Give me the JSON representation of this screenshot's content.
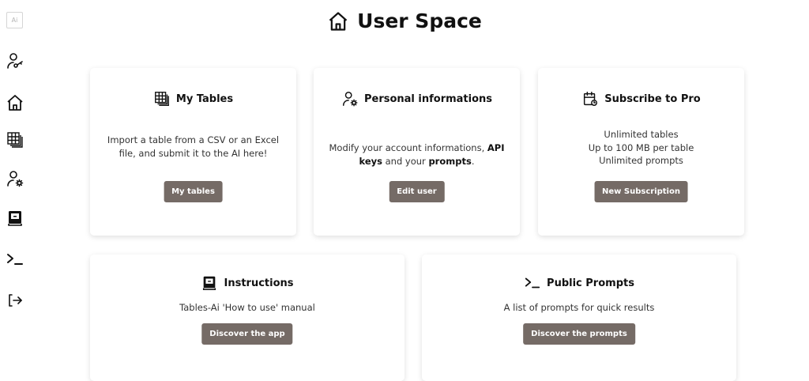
{
  "sidebar": {
    "logo": "Ai",
    "items": [
      {
        "icon": "user-key-icon"
      },
      {
        "icon": "home-icon"
      },
      {
        "icon": "tables-icon"
      },
      {
        "icon": "user-gear-icon"
      },
      {
        "icon": "manual-icon"
      },
      {
        "icon": "terminal-icon"
      },
      {
        "icon": "logout-icon"
      }
    ]
  },
  "header": {
    "title": "User Space",
    "icon": "home-icon"
  },
  "cards": {
    "tables": {
      "title": "My Tables",
      "text": "Import a table from a CSV or an Excel file, and submit it to the AI here!",
      "button": "My tables"
    },
    "personal": {
      "title": "Personal informations",
      "text_part1": "Modify your account informations, ",
      "text_bold1": "API keys",
      "text_part2": " and your ",
      "text_bold2": "prompts",
      "text_part3": ".",
      "button": "Edit user"
    },
    "subscribe": {
      "title": "Subscribe to Pro",
      "lines": [
        "Unlimited tables",
        "Up to 100 MB per table",
        "Unlimited prompts"
      ],
      "button": "New Subscription"
    },
    "instructions": {
      "title": "Instructions",
      "text": "Tables-Ai 'How to use' manual",
      "button": "Discover the app"
    },
    "prompts": {
      "title": "Public Prompts",
      "text": "A list of prompts for quick results",
      "button": "Discover the prompts"
    }
  },
  "colors": {
    "button": "#756b66",
    "text": "#1a1a1a",
    "background": "#ffffff"
  }
}
